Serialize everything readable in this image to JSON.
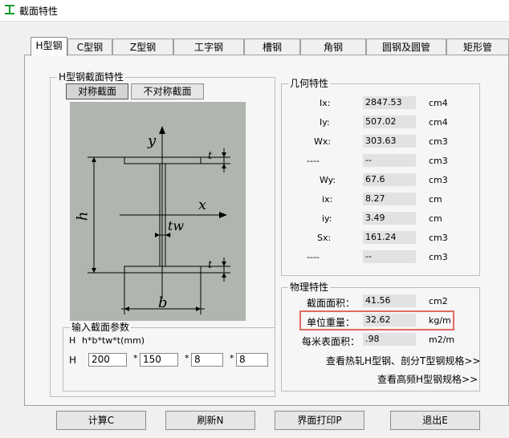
{
  "window": {
    "title": "截面特性"
  },
  "tabs": [
    "H型钢",
    "C型钢",
    "Z型钢",
    "工字钢",
    "槽钢",
    "角钢",
    "圆钢及圆管",
    "矩形管"
  ],
  "h_section_group": {
    "title": "H型钢截面特性",
    "symmetric_button": "对称截面",
    "asymmetric_button": "不对称截面"
  },
  "drawing_labels": {
    "y_axis": "y",
    "x_axis": "x",
    "tw": "tw",
    "t_top": "t",
    "t_bottom": "t",
    "h": "h",
    "b": "b"
  },
  "geometry": {
    "title": "几何特性",
    "rows": [
      {
        "label": "Ix:",
        "value": "2847.53",
        "unit": "cm4"
      },
      {
        "label": "Iy:",
        "value": "507.02",
        "unit": "cm4"
      },
      {
        "label": "Wx:",
        "value": "303.63",
        "unit": "cm3"
      },
      {
        "label": "----",
        "value": "--",
        "unit": "cm3"
      },
      {
        "label": "Wy:",
        "value": "67.6",
        "unit": "cm3"
      },
      {
        "label": "ix:",
        "value": "8.27",
        "unit": "cm"
      },
      {
        "label": "iy:",
        "value": "3.49",
        "unit": "cm"
      },
      {
        "label": "Sx:",
        "value": "161.24",
        "unit": "cm3"
      },
      {
        "label": "----",
        "value": "--",
        "unit": "cm3"
      }
    ]
  },
  "physical": {
    "title": "物理特性",
    "rows": [
      {
        "label": "截面面积：",
        "value": "41.56",
        "unit": "cm2"
      },
      {
        "label": "单位重量：",
        "value": "32.62",
        "unit": "kg/m"
      },
      {
        "label": "每米表面积：",
        "value": ".98",
        "unit": "m2/m"
      }
    ],
    "link1": "查看热轧H型钢、剖分T型钢规格>>",
    "link2": "查看高频H型钢规格>>"
  },
  "input": {
    "title": "输入截面参数",
    "param_label": "H",
    "format": "h*b*tw*t(mm)",
    "row_label": "H",
    "h": "200",
    "b": "150",
    "tw": "8",
    "t": "8",
    "sep": "*"
  },
  "buttons": {
    "calc": "计算C",
    "refresh": "刷新N",
    "print": "界面打印P",
    "exit": "退出E"
  },
  "colors": {
    "highlight": "#e06b5e",
    "drawing_bg": "#b0b6af"
  }
}
